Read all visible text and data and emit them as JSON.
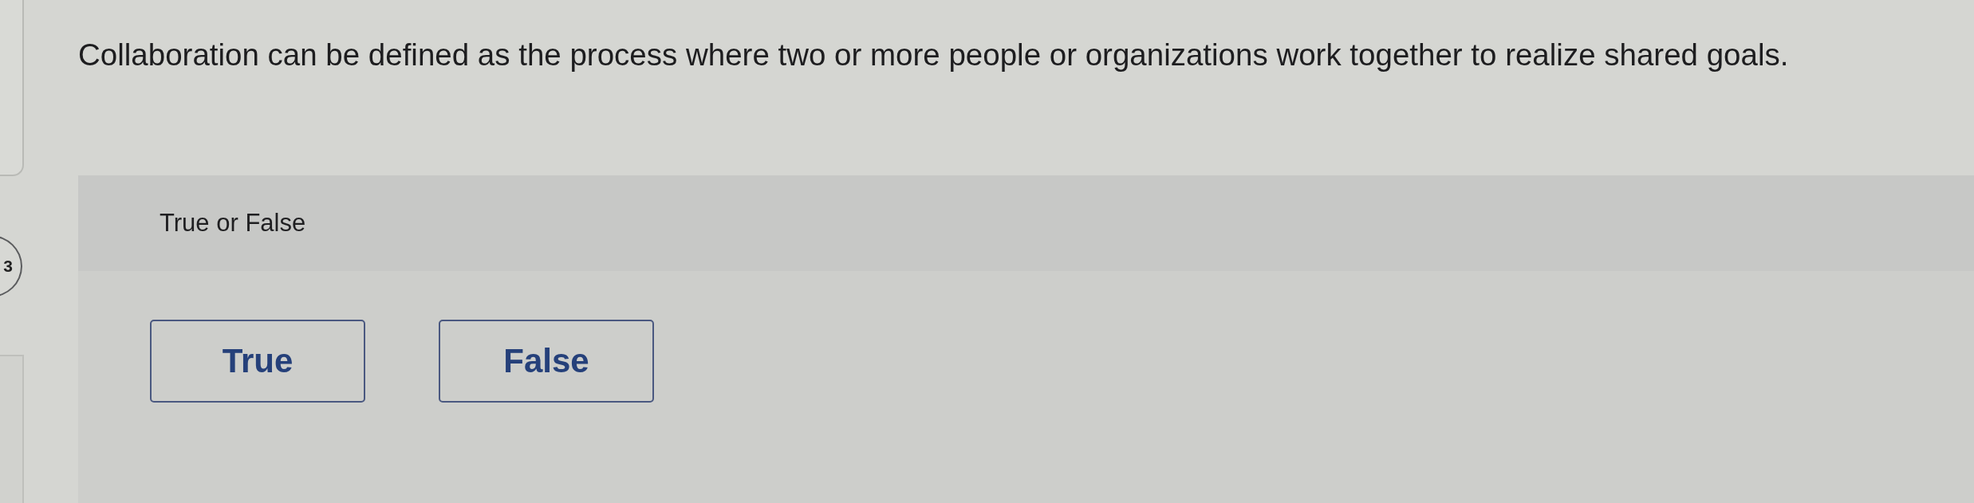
{
  "question_number": "3",
  "question": {
    "text": "Collaboration can be defined as the process where two or more people or organizations work together to realize shared goals."
  },
  "answer_panel": {
    "prompt": "True or False",
    "options": [
      {
        "label": "True",
        "selected": false
      },
      {
        "label": "False",
        "selected": false
      }
    ]
  }
}
